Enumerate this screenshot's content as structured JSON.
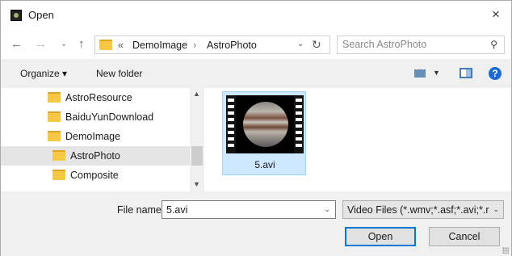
{
  "window": {
    "title": "Open",
    "close_label": "×"
  },
  "navbar": {
    "back_glyph": "←",
    "forward_glyph": "→",
    "recent_glyph": "⌄",
    "up_glyph": "↑",
    "breadcrumb": {
      "overflow": "«",
      "items": [
        "DemoImage",
        "AstroPhoto"
      ],
      "separator": "›"
    },
    "address_dropdown_glyph": "⌄",
    "refresh_glyph": "↻",
    "search_placeholder": "Search AstroPhoto",
    "search_glyph": "⚲"
  },
  "toolbar": {
    "organize_label": "Organize ▾",
    "new_folder_label": "New folder",
    "view_dropdown_glyph": "▼",
    "help_label": "?"
  },
  "tree": {
    "items": [
      {
        "label": "AstroResource",
        "selected": false
      },
      {
        "label": "BaiduYunDownload",
        "selected": false
      },
      {
        "label": "DemoImage",
        "selected": false
      },
      {
        "label": "AstroPhoto",
        "selected": true
      },
      {
        "label": "Composite",
        "selected": false
      }
    ],
    "scroll_up_glyph": "▲",
    "scroll_down_glyph": "▼"
  },
  "files": [
    {
      "name": "5.avi",
      "icon": "video-thumbnail-jupiter",
      "selected": true
    }
  ],
  "bottom": {
    "file_name_label": "File name:",
    "file_name_value": "5.avi",
    "file_name_dropdown_glyph": "⌄",
    "filter_value": "Video Files (*.wmv;*.asf;*.avi;*.r",
    "filter_dropdown_glyph": "⌄",
    "open_label": "Open",
    "cancel_label": "Cancel"
  },
  "colors": {
    "accent": "#0078d7",
    "selection": "#cde8ff",
    "folder": "#f6c844"
  }
}
